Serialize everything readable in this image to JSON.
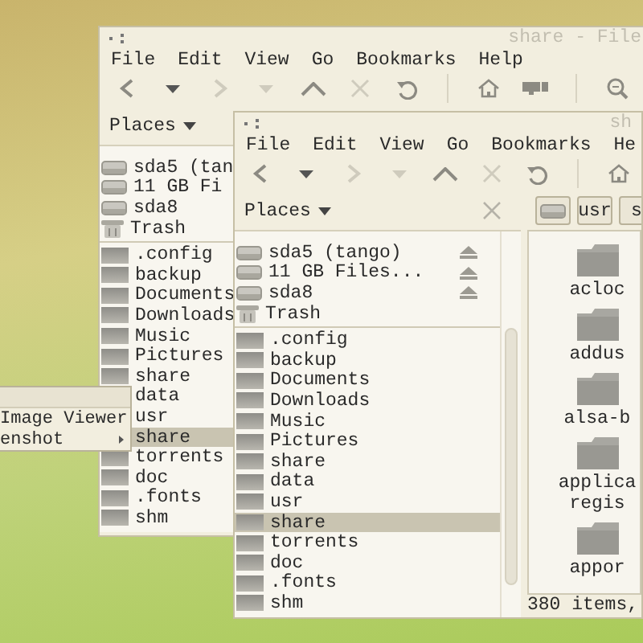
{
  "windows": [
    {
      "title": "share - File",
      "menu": [
        "File",
        "Edit",
        "View",
        "Go",
        "Bookmarks",
        "Help"
      ],
      "toolbar": [
        {
          "kind": "back",
          "disabled": false
        },
        {
          "kind": "dropdown",
          "disabled": false
        },
        {
          "kind": "forward",
          "disabled": true
        },
        {
          "kind": "dropdown",
          "disabled": true
        },
        {
          "kind": "up",
          "disabled": false
        },
        {
          "kind": "stop",
          "disabled": true
        },
        {
          "kind": "reload",
          "disabled": false
        },
        {
          "kind": "separator",
          "disabled": false
        },
        {
          "kind": "home",
          "disabled": false
        },
        {
          "kind": "computer",
          "disabled": false
        },
        {
          "kind": "separator",
          "disabled": false
        },
        {
          "kind": "zoom",
          "disabled": false
        }
      ],
      "places": {
        "label": "Places",
        "close_button": false
      },
      "sidebar": [
        {
          "kind": "drive",
          "label": "sda5 (tan",
          "selected": false
        },
        {
          "kind": "drive",
          "label": "11 GB Fi",
          "selected": false
        },
        {
          "kind": "drive",
          "label": "sda8",
          "selected": false
        },
        {
          "kind": "trash",
          "label": "Trash",
          "selected": false
        },
        {
          "kind": "folder",
          "label": ".config",
          "selected": false
        },
        {
          "kind": "folder",
          "label": "backup",
          "selected": false
        },
        {
          "kind": "folder",
          "label": "Documents",
          "selected": false
        },
        {
          "kind": "folder",
          "label": "Downloads",
          "selected": false
        },
        {
          "kind": "folder",
          "label": "Music",
          "selected": false
        },
        {
          "kind": "folder",
          "label": "Pictures",
          "selected": false
        },
        {
          "kind": "folder",
          "label": "share",
          "selected": false
        },
        {
          "kind": "folder",
          "label": "data",
          "selected": false
        },
        {
          "kind": "folder",
          "label": "usr",
          "selected": false
        },
        {
          "kind": "folder",
          "label": "share",
          "selected": true
        },
        {
          "kind": "folder",
          "label": "torrents",
          "selected": false
        },
        {
          "kind": "folder",
          "label": "doc",
          "selected": false
        },
        {
          "kind": "folder",
          "label": ".fonts",
          "selected": false
        },
        {
          "kind": "folder",
          "label": "shm",
          "selected": false
        }
      ]
    },
    {
      "title": "sh",
      "menu": [
        "File",
        "Edit",
        "View",
        "Go",
        "Bookmarks",
        "He"
      ],
      "toolbar": [
        {
          "kind": "back",
          "disabled": false
        },
        {
          "kind": "dropdown",
          "disabled": false
        },
        {
          "kind": "forward",
          "disabled": true
        },
        {
          "kind": "dropdown",
          "disabled": true
        },
        {
          "kind": "up",
          "disabled": false
        },
        {
          "kind": "stop",
          "disabled": true
        },
        {
          "kind": "reload",
          "disabled": false
        },
        {
          "kind": "separator",
          "disabled": false
        },
        {
          "kind": "home",
          "disabled": false
        }
      ],
      "places": {
        "label": "Places",
        "close_button": true
      },
      "sidebar": [
        {
          "kind": "drive",
          "label": "sda5 (tango)",
          "eject": true,
          "selected": false
        },
        {
          "kind": "drive",
          "label": "11 GB Files...",
          "eject": true,
          "selected": false
        },
        {
          "kind": "drive",
          "label": "sda8",
          "eject": true,
          "selected": false
        },
        {
          "kind": "trash",
          "label": "Trash",
          "selected": false
        },
        {
          "kind": "folder",
          "label": ".config",
          "selected": false
        },
        {
          "kind": "folder",
          "label": "backup",
          "selected": false
        },
        {
          "kind": "folder",
          "label": "Documents",
          "selected": false
        },
        {
          "kind": "folder",
          "label": "Downloads",
          "selected": false
        },
        {
          "kind": "folder",
          "label": "Music",
          "selected": false
        },
        {
          "kind": "folder",
          "label": "Pictures",
          "selected": false
        },
        {
          "kind": "folder",
          "label": "share",
          "selected": false
        },
        {
          "kind": "folder",
          "label": "data",
          "selected": false
        },
        {
          "kind": "folder",
          "label": "usr",
          "selected": false
        },
        {
          "kind": "folder",
          "label": "share",
          "selected": true
        },
        {
          "kind": "folder",
          "label": "torrents",
          "selected": false
        },
        {
          "kind": "folder",
          "label": "doc",
          "selected": false
        },
        {
          "kind": "folder",
          "label": ".fonts",
          "selected": false
        },
        {
          "kind": "folder",
          "label": "shm",
          "selected": false
        }
      ],
      "path_bar": [
        {
          "kind": "drive"
        },
        {
          "kind": "text",
          "label": "usr"
        },
        {
          "kind": "text",
          "label": "s"
        }
      ],
      "files": [
        {
          "label": "acloc"
        },
        {
          "label": "addus"
        },
        {
          "label": "alsa-b"
        },
        {
          "label": "applica\nregis"
        },
        {
          "label": "appor"
        }
      ],
      "status": "380 items,"
    }
  ],
  "popup_menu": {
    "items": [
      {
        "label": "Image Viewer",
        "submenu": false
      },
      {
        "label": "enshot",
        "submenu": true
      }
    ]
  }
}
